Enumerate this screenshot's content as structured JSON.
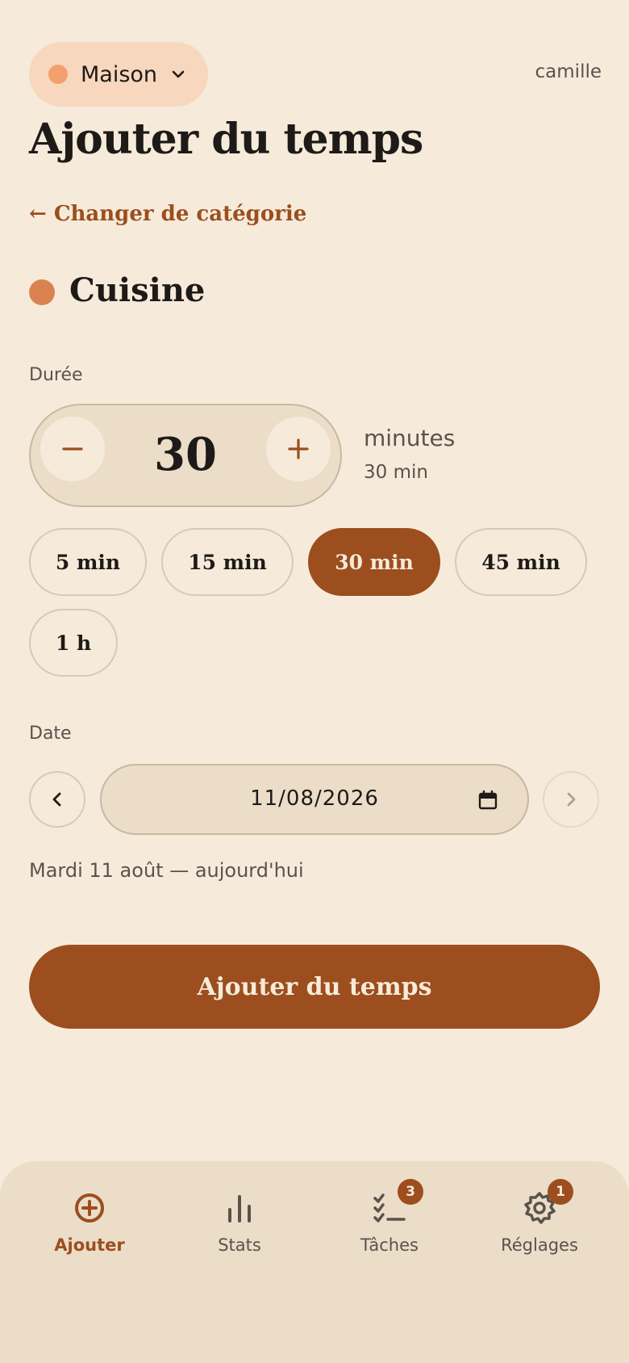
{
  "header": {
    "household": "Maison",
    "user": "camille",
    "title": "Ajouter du temps",
    "back_link": "← Changer de catégorie"
  },
  "category": {
    "name": "Cuisine",
    "color": "#DB8350"
  },
  "duration": {
    "label": "Durée",
    "value": "30",
    "unit": "minutes",
    "summary": "30 min",
    "presets": [
      "5 min",
      "15 min",
      "30 min",
      "45 min",
      "1 h"
    ],
    "selected_preset": "30 min"
  },
  "date": {
    "label": "Date",
    "value": "11/08/2026",
    "description": "Mardi 11 août — aujourd'hui"
  },
  "submit_label": "Ajouter du temps",
  "bottom_nav": {
    "items": [
      {
        "label": "Ajouter",
        "icon": "plus-circle-icon",
        "active": true
      },
      {
        "label": "Stats",
        "icon": "bar-chart-icon"
      },
      {
        "label": "Tâches",
        "icon": "checklist-icon",
        "badge": "3"
      },
      {
        "label": "Réglages",
        "icon": "gear-icon",
        "badge": "1"
      }
    ]
  },
  "colors": {
    "background": "#F6EBDB",
    "accent": "#9C4E1E",
    "household_dot": "#F4A06E"
  }
}
